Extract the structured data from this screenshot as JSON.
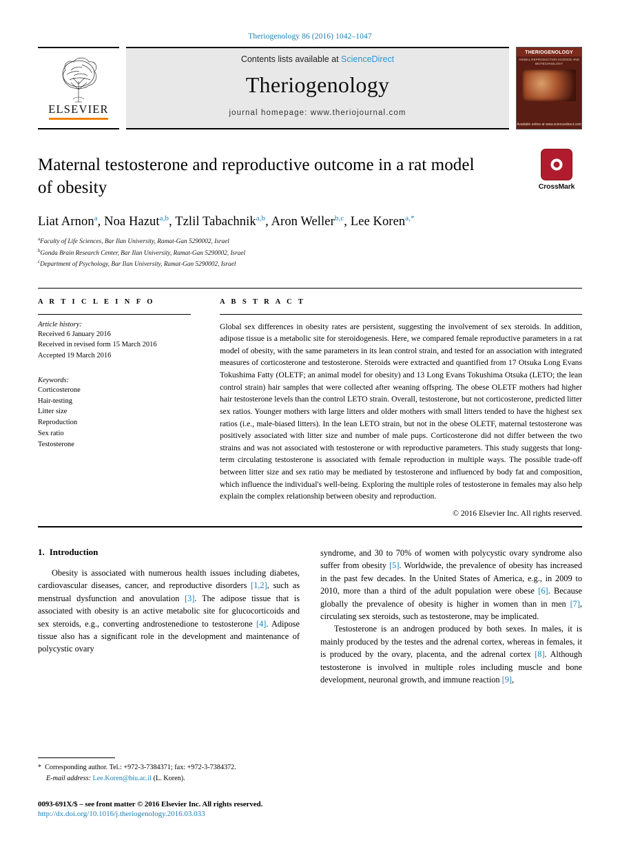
{
  "running_head": "Theriogenology 86 (2016) 1042–1047",
  "masthead": {
    "publisher_name": "ELSEVIER",
    "contents_prefix": "Contents lists available at ",
    "contents_link": "ScienceDirect",
    "journal_title": "Theriogenology",
    "homepage": "journal homepage: www.theriojournal.com",
    "cover": {
      "title": "THERIOGENOLOGY",
      "subtitle": "ANIMAL REPRODUCTION SCIENCE AND BIOTECHNOLOGY",
      "footer": "Available online at www.sciencedirect.com"
    }
  },
  "article": {
    "title": "Maternal testosterone and reproductive outcome in a rat model of obesity",
    "crossmark_label": "CrossMark",
    "authors": [
      {
        "name": "Liat Arnon",
        "sup": "a",
        "sep": ", "
      },
      {
        "name": "Noa Hazut",
        "sup": "a,b",
        "sep": ", "
      },
      {
        "name": "Tzlil Tabachnik",
        "sup": "a,b",
        "sep": ", "
      },
      {
        "name": "Aron Weller",
        "sup": "b,c",
        "sep": ", "
      },
      {
        "name": "Lee Koren",
        "sup": "a,*",
        "sep": ""
      }
    ],
    "affiliations": [
      {
        "sup": "a",
        "text": "Faculty of Life Sciences, Bar Ilan University, Ramat-Gan 5290002, Israel"
      },
      {
        "sup": "b",
        "text": "Gonda Brain Research Center, Bar Ilan University, Ramat-Gan 5290002, Israel"
      },
      {
        "sup": "c",
        "text": "Department of Psychology, Bar Ilan University, Ramat-Gan 5290002, Israel"
      }
    ]
  },
  "article_info": {
    "heading": "A R T I C L E   I N F O",
    "history_label": "Article history:",
    "history": [
      "Received 6 January 2016",
      "Received in revised form 15 March 2016",
      "Accepted 19 March 2016"
    ],
    "keywords_label": "Keywords:",
    "keywords": [
      "Corticosterone",
      "Hair-testing",
      "Litter size",
      "Reproduction",
      "Sex ratio",
      "Testosterone"
    ]
  },
  "abstract": {
    "heading": "A B S T R A C T",
    "text": "Global sex differences in obesity rates are persistent, suggesting the involvement of sex steroids. In addition, adipose tissue is a metabolic site for steroidogenesis. Here, we compared female reproductive parameters in a rat model of obesity, with the same parameters in its lean control strain, and tested for an association with integrated measures of corticosterone and testosterone. Steroids were extracted and quantified from 17 Otsuka Long Evans Tokushima Fatty (OLETF; an animal model for obesity) and 13 Long Evans Tokushima Otsuka (LETO; the lean control strain) hair samples that were collected after weaning offspring. The obese OLETF mothers had higher hair testosterone levels than the control LETO strain. Overall, testosterone, but not corticosterone, predicted litter sex ratios. Younger mothers with large litters and older mothers with small litters tended to have the highest sex ratios (i.e., male-biased litters). In the lean LETO strain, but not in the obese OLETF, maternal testosterone was positively associated with litter size and number of male pups. Corticosterone did not differ between the two strains and was not associated with testosterone or with reproductive parameters. This study suggests that long-term circulating testosterone is associated with female reproduction in multiple ways. The possible trade-off between litter size and sex ratio may be mediated by testosterone and influenced by body fat and composition, which influence the individual's well-being. Exploring the multiple roles of testosterone in females may also help explain the complex relationship between obesity and reproduction.",
    "copyright": "© 2016 Elsevier Inc. All rights reserved."
  },
  "body": {
    "section_number": "1.",
    "section_title": "Introduction",
    "left_paragraph_1": {
      "part1": "Obesity is associated with numerous health issues including diabetes, cardiovascular diseases, cancer, and reproductive disorders ",
      "ref1": "[1,2]",
      "part2": ", such as menstrual dysfunction and anovulation ",
      "ref2": "[3]",
      "part3": ". The adipose tissue that is associated with obesity is an active metabolic site for glucocorticoids and sex steroids, e.g., converting androstenedione to testosterone ",
      "ref3": "[4]",
      "part4": ". Adipose tissue also has a significant role in the development and maintenance of polycystic ovary"
    },
    "right_paragraph_1": {
      "part1": "syndrome, and 30 to 70% of women with polycystic ovary syndrome also suffer from obesity ",
      "ref1": "[5]",
      "part2": ". Worldwide, the prevalence of obesity has increased in the past few decades. In the United States of America, e.g., in 2009 to 2010, more than a third of the adult population were obese ",
      "ref2": "[6]",
      "part3": ". Because globally the prevalence of obesity is higher in women than in men ",
      "ref3": "[7]",
      "part4": ", circulating sex steroids, such as testosterone, may be implicated."
    },
    "right_paragraph_2": {
      "part1": "Testosterone is an androgen produced by both sexes. In males, it is mainly produced by the testes and the adrenal cortex, whereas in females, it is produced by the ovary, placenta, and the adrenal cortex ",
      "ref1": "[8]",
      "part2": ". Although testosterone is involved in multiple roles including muscle and bone development, neuronal growth, and immune reaction ",
      "ref2": "[9]",
      "part3": ","
    }
  },
  "footnote": {
    "star": "*",
    "corresponding": "Corresponding author. Tel.: +972-3-7384371; fax: +972-3-7384372.",
    "email_label": "E-mail address:",
    "email": "Lee.Koren@biu.ac.il",
    "email_owner": "(L. Koren)."
  },
  "footer": {
    "issn_line": "0093-691X/$ – see front matter © 2016 Elsevier Inc. All rights reserved.",
    "doi": "http://dx.doi.org/10.1016/j.theriogenology.2016.03.033"
  }
}
